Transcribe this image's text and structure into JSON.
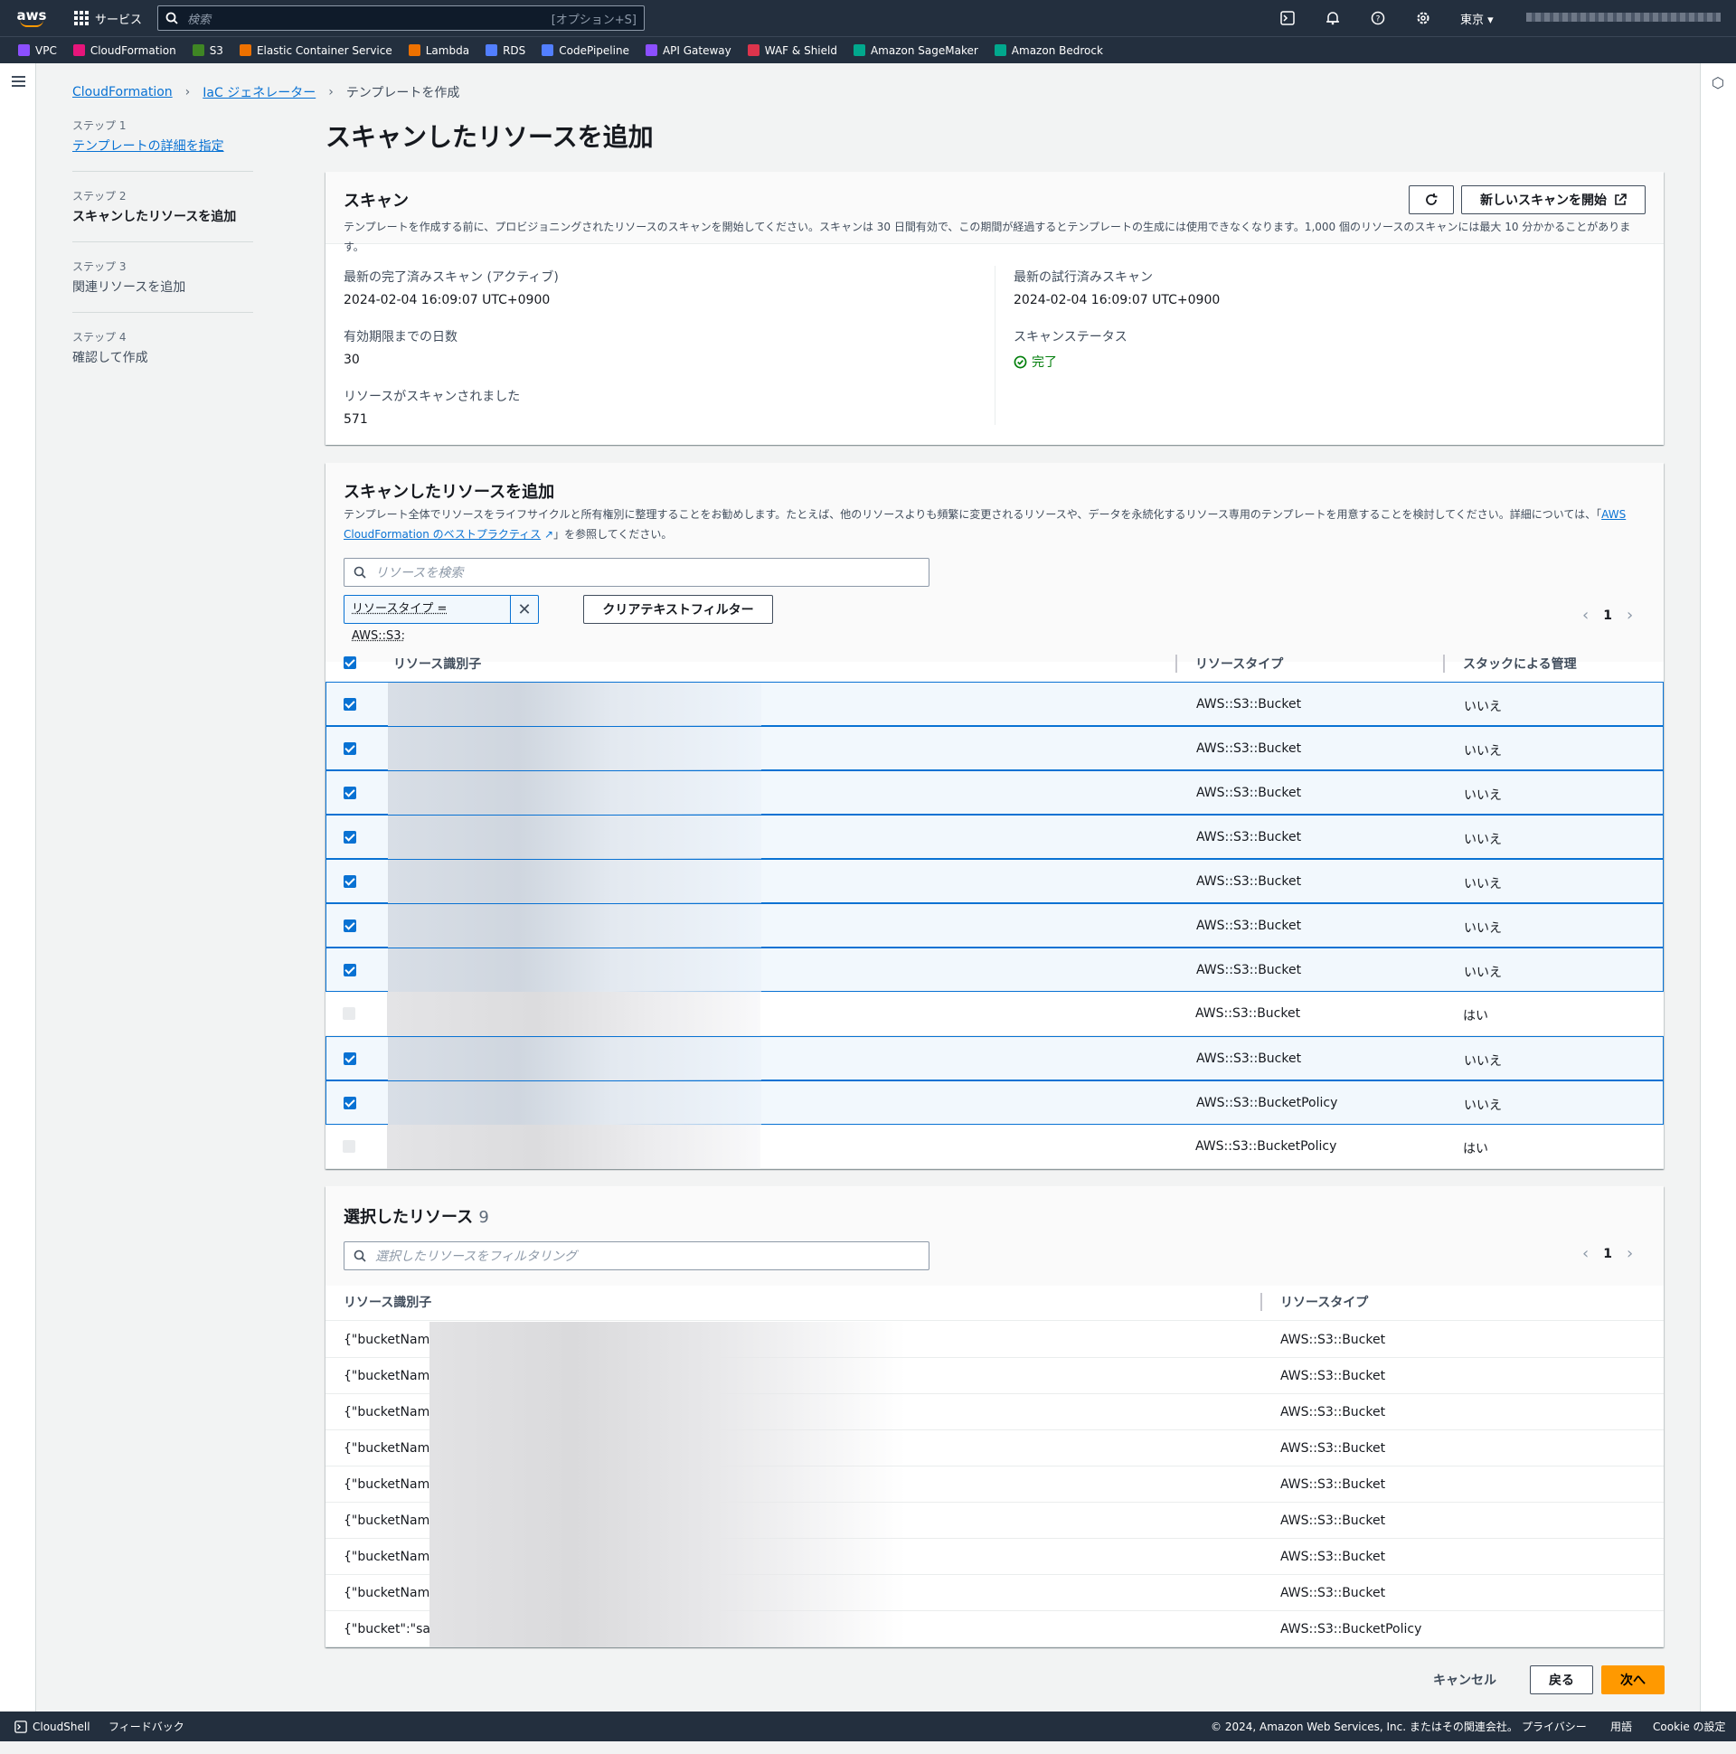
{
  "topbar": {
    "logo": "aws",
    "services_label": "サービス",
    "search_placeholder": "検索",
    "search_shortcut": "[オプション+S]",
    "region": "東京 ▾",
    "icons": [
      "cloudshell-icon",
      "bell-icon",
      "help-icon",
      "gear-icon"
    ]
  },
  "favorites": [
    {
      "label": "VPC",
      "color": "#8c4fff"
    },
    {
      "label": "CloudFormation",
      "color": "#e7157b"
    },
    {
      "label": "S3",
      "color": "#3f8624"
    },
    {
      "label": "Elastic Container Service",
      "color": "#ed7100"
    },
    {
      "label": "Lambda",
      "color": "#ed7100"
    },
    {
      "label": "RDS",
      "color": "#527fff"
    },
    {
      "label": "CodePipeline",
      "color": "#527fff"
    },
    {
      "label": "API Gateway",
      "color": "#8c4fff"
    },
    {
      "label": "WAF & Shield",
      "color": "#dd344c"
    },
    {
      "label": "Amazon SageMaker",
      "color": "#01a88d"
    },
    {
      "label": "Amazon Bedrock",
      "color": "#01a88d"
    }
  ],
  "breadcrumb": {
    "items": [
      "CloudFormation",
      "IaC ジェネレーター"
    ],
    "current": "テンプレートを作成"
  },
  "steps": [
    {
      "num": "ステップ 1",
      "label": "テンプレートの詳細を指定"
    },
    {
      "num": "ステップ 2",
      "label": "スキャンしたリソースを追加"
    },
    {
      "num": "ステップ 3",
      "label": "関連リソースを追加"
    },
    {
      "num": "ステップ 4",
      "label": "確認して作成"
    }
  ],
  "page_title": "スキャンしたリソースを追加",
  "scan": {
    "title": "スキャン",
    "description": "テンプレートを作成する前に、プロビジョニングされたリソースのスキャンを開始してください。スキャンは 30 日間有効で、この期間が経過するとテンプレートの生成には使用できなくなります。1,000 個のリソースのスキャンには最大 10 分かかることがあります。",
    "new_scan_button": "新しいスキャンを開始",
    "last_completed_label": "最新の完了済みスキャン (アクティブ)",
    "last_completed_value": "2024-02-04 16:09:07 UTC+0900",
    "days_label": "有効期限までの日数",
    "days_value": "30",
    "resources_label": "リソースがスキャンされました",
    "resources_value": "571",
    "last_attempted_label": "最新の試行済みスキャン",
    "last_attempted_value": "2024-02-04 16:09:07 UTC+0900",
    "status_label": "スキャンステータス",
    "status_value": "完了",
    "status_color": "#037f0c"
  },
  "add": {
    "title": "スキャンしたリソースを追加",
    "desc1": "テンプレート全体でリソースをライフサイクルと所有権別に整理することをお勧めします。たとえば、他のリソースよりも頻繁に変更されるリソースや、データを永続化するリソース専用のテンプレートを用意することを検討してください。詳細については、「",
    "desc_link1": "AWS",
    "desc_link2": "CloudFormation のベストプラクティス",
    "desc2": "」を参照してください。",
    "search_placeholder": "リソースを検索",
    "filter_token": "リソースタイプ = AWS::S3:",
    "clear_button": "クリアテキストフィルター",
    "page": "1",
    "columns": [
      "リソース識別子",
      "リソースタイプ",
      "スタックによる管理"
    ],
    "rows": [
      {
        "checked": true,
        "type": "AWS::S3::Bucket",
        "managed": "いいえ"
      },
      {
        "checked": true,
        "type": "AWS::S3::Bucket",
        "managed": "いいえ"
      },
      {
        "checked": true,
        "type": "AWS::S3::Bucket",
        "managed": "いいえ"
      },
      {
        "checked": true,
        "type": "AWS::S3::Bucket",
        "managed": "いいえ"
      },
      {
        "checked": true,
        "type": "AWS::S3::Bucket",
        "managed": "いいえ"
      },
      {
        "checked": true,
        "type": "AWS::S3::Bucket",
        "managed": "いいえ"
      },
      {
        "checked": true,
        "type": "AWS::S3::Bucket",
        "managed": "いいえ"
      },
      {
        "checked": false,
        "type": "AWS::S3::Bucket",
        "managed": "はい"
      },
      {
        "checked": true,
        "type": "AWS::S3::Bucket",
        "managed": "いいえ"
      },
      {
        "checked": true,
        "type": "AWS::S3::BucketPolicy",
        "managed": "いいえ"
      },
      {
        "checked": false,
        "type": "AWS::S3::BucketPolicy",
        "managed": "はい"
      }
    ]
  },
  "selected": {
    "title": "選択したリソース",
    "count": "9",
    "filter_placeholder": "選択したリソースをフィルタリング",
    "page": "1",
    "columns": [
      "リソース識別子",
      "リソースタイプ"
    ],
    "rows": [
      {
        "id": "{\"bucketName\"",
        "type": "AWS::S3::Bucket"
      },
      {
        "id": "{\"bucketName\"",
        "type": "AWS::S3::Bucket"
      },
      {
        "id": "{\"bucketName\"",
        "type": "AWS::S3::Bucket"
      },
      {
        "id": "{\"bucketName\"",
        "type": "AWS::S3::Bucket"
      },
      {
        "id": "{\"bucketName\"",
        "type": "AWS::S3::Bucket"
      },
      {
        "id": "{\"bucketName\"",
        "type": "AWS::S3::Bucket"
      },
      {
        "id": "{\"bucketName\"",
        "type": "AWS::S3::Bucket"
      },
      {
        "id": "{\"bucketName\"",
        "type": "AWS::S3::Bucket"
      },
      {
        "id": "{\"bucket\":\"sage",
        "type": "AWS::S3::BucketPolicy"
      }
    ]
  },
  "actions": {
    "cancel": "キャンセル",
    "back": "戻る",
    "next": "次へ"
  },
  "footer": {
    "cloudshell": "CloudShell",
    "feedback": "フィードバック",
    "copyright": "© 2024, Amazon Web Services, Inc. またはその関連会社。",
    "privacy": "プライバシー",
    "terms": "用語",
    "cookie": "Cookie の設定"
  }
}
